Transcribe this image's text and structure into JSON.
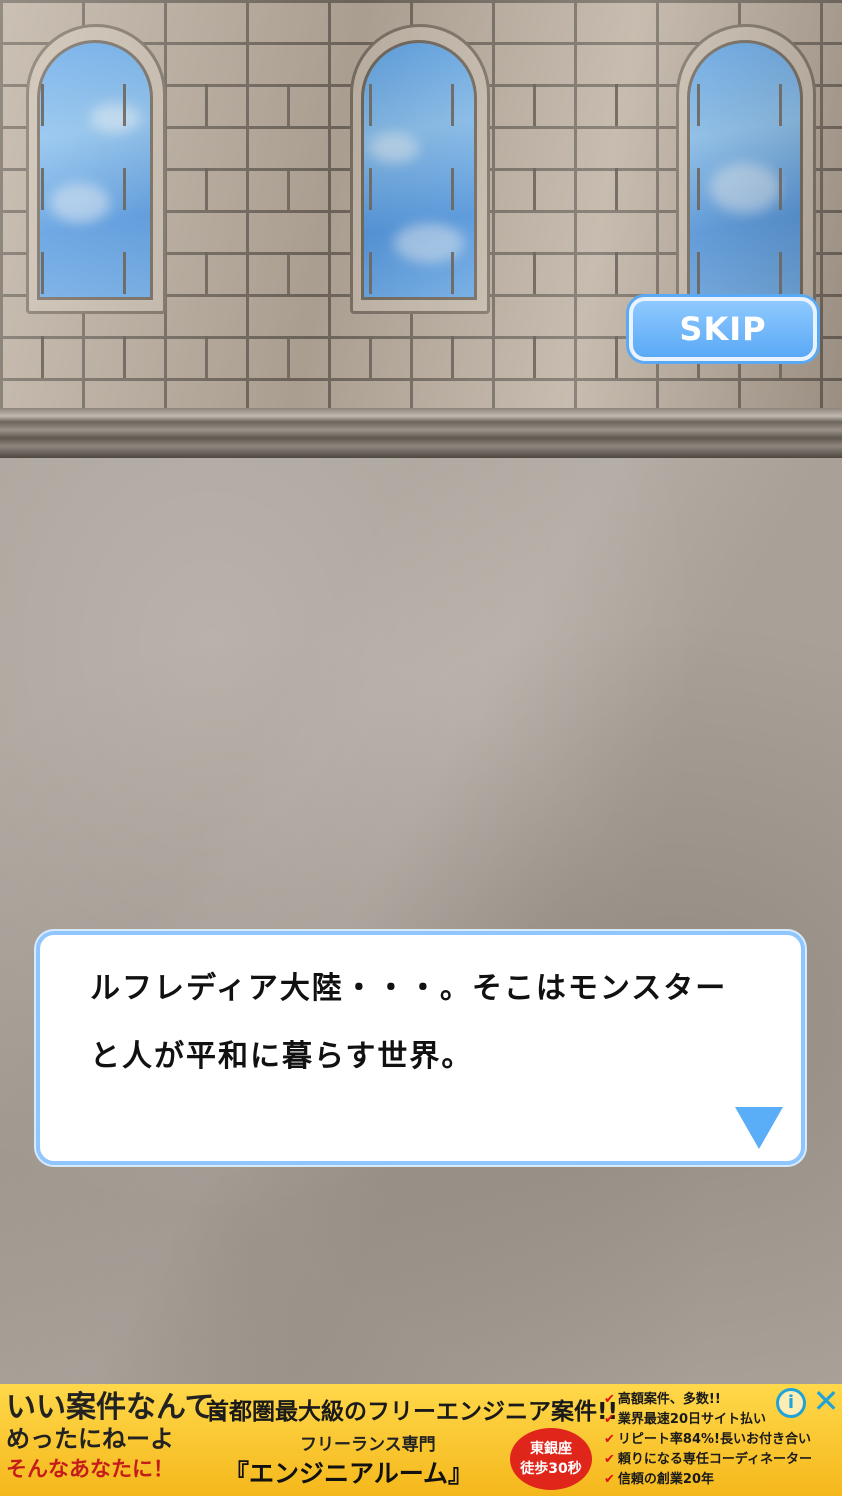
{
  "scene": {
    "skip_label": "SKIP"
  },
  "dialogue": {
    "lines": [
      "ルフレディア大陸・・・。そこはモンスター",
      "と人が平和に暮らす世界。"
    ],
    "next_icon": "triangle-down-icon"
  },
  "ad": {
    "left_line1": "いい案件なんて、",
    "left_line2": "めったにねーよ",
    "left_line3": "そんなあなたに！",
    "headline": "首都圏最大級のフリーエンジニア案件!!",
    "sub": "フリーランス専門",
    "brand": "『エンジニアルーム』",
    "badge_line1": "東銀座",
    "badge_line2": "徒歩30秒",
    "checks": [
      "高額案件、多数!!",
      "業界最速20日サイト払い",
      "リピート率84%!長いお付き合い",
      "頼りになる専任コーディネーター",
      "信頼の創業20年"
    ],
    "info_icon": "info-icon",
    "close_icon": "close-icon",
    "info_glyph": "i",
    "close_glyph": "✕"
  }
}
